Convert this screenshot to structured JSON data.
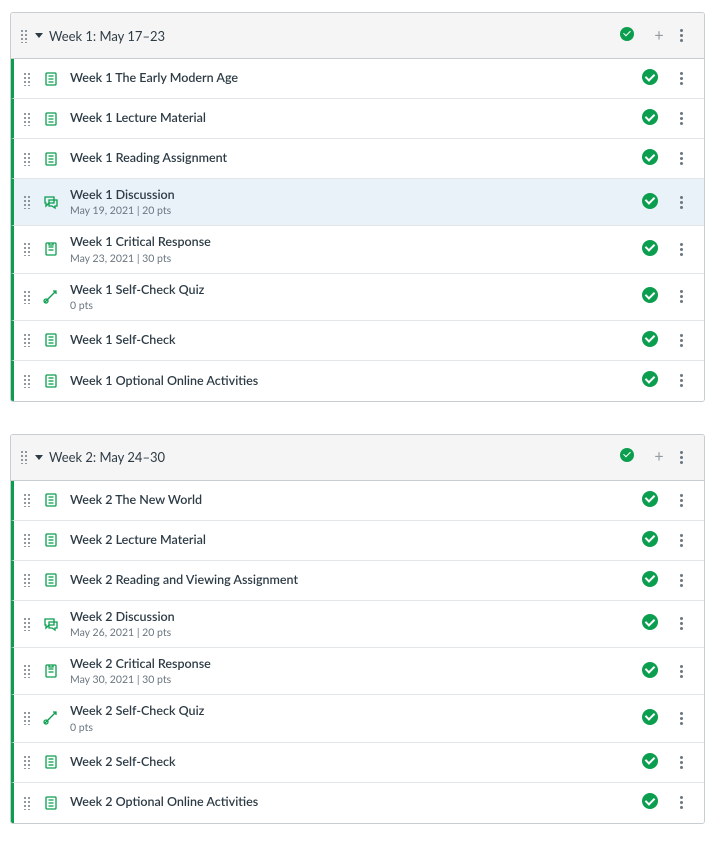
{
  "modules": [
    {
      "title": "Week 1: May 17–23",
      "items": [
        {
          "icon": "page",
          "title": "Week 1 The Early Modern Age",
          "meta": "",
          "selected": false
        },
        {
          "icon": "page",
          "title": "Week 1 Lecture Material",
          "meta": "",
          "selected": false
        },
        {
          "icon": "page",
          "title": "Week 1 Reading Assignment",
          "meta": "",
          "selected": false
        },
        {
          "icon": "discussion",
          "title": "Week 1 Discussion",
          "meta": "May 19, 2021  |  20 pts",
          "selected": true
        },
        {
          "icon": "assignment",
          "title": "Week 1 Critical Response",
          "meta": "May 23, 2021  |  30 pts",
          "selected": false
        },
        {
          "icon": "quiz",
          "title": "Week 1 Self-Check Quiz",
          "meta": "0 pts",
          "selected": false
        },
        {
          "icon": "page",
          "title": "Week 1 Self-Check",
          "meta": "",
          "selected": false
        },
        {
          "icon": "page",
          "title": "Week 1 Optional Online Activities",
          "meta": "",
          "selected": false
        }
      ]
    },
    {
      "title": "Week 2: May 24–30",
      "items": [
        {
          "icon": "page",
          "title": "Week 2 The New World",
          "meta": "",
          "selected": false
        },
        {
          "icon": "page",
          "title": "Week 2 Lecture Material",
          "meta": "",
          "selected": false
        },
        {
          "icon": "page",
          "title": "Week 2 Reading and Viewing Assignment",
          "meta": "",
          "selected": false
        },
        {
          "icon": "discussion",
          "title": "Week 2 Discussion",
          "meta": "May 26, 2021  |  20 pts",
          "selected": false
        },
        {
          "icon": "assignment",
          "title": "Week 2 Critical Response",
          "meta": "May 30, 2021  |  30 pts",
          "selected": false
        },
        {
          "icon": "quiz",
          "title": "Week 2 Self-Check Quiz",
          "meta": "0 pts",
          "selected": false
        },
        {
          "icon": "page",
          "title": "Week 2 Self-Check",
          "meta": "",
          "selected": false
        },
        {
          "icon": "page",
          "title": "Week 2 Optional Online Activities",
          "meta": "",
          "selected": false
        }
      ]
    }
  ]
}
